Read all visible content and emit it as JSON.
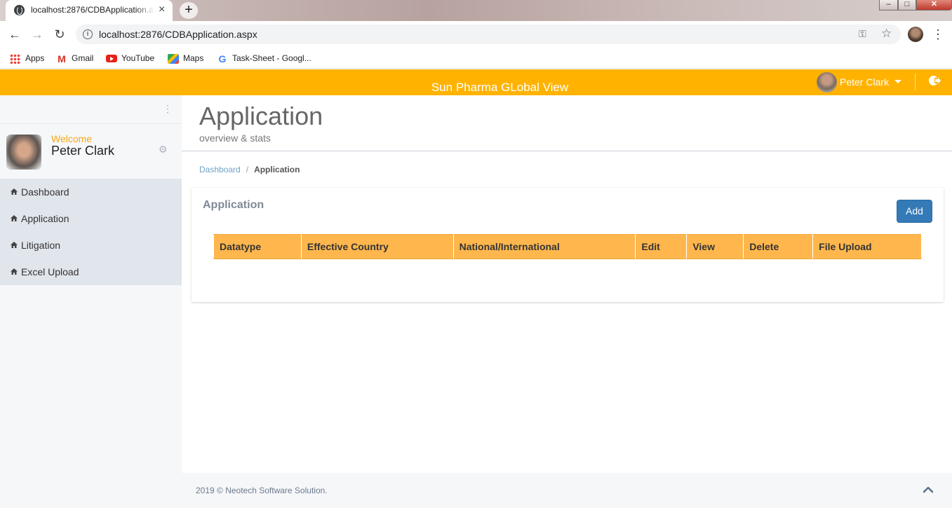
{
  "browser": {
    "tab_title": "localhost:2876/CDBApplication.aspx",
    "tab_close": "×",
    "new_tab": "+",
    "url": "localhost:2876/CDBApplication.aspx",
    "window_min": "–",
    "window_max": "□",
    "window_close": "✕",
    "bookmarks": [
      {
        "label": "Apps",
        "icon": "apps-grid-icon"
      },
      {
        "label": "Gmail",
        "icon": "gmail-icon"
      },
      {
        "label": "YouTube",
        "icon": "youtube-icon"
      },
      {
        "label": "Maps",
        "icon": "maps-icon"
      },
      {
        "label": "Task-Sheet - Googl...",
        "icon": "google-icon"
      }
    ]
  },
  "header": {
    "title": "Sun Pharma GLobal View",
    "user_name": "Peter Clark",
    "accent": "#ffb300"
  },
  "sidebar": {
    "welcome": "Welcome",
    "user_name": "Peter Clark",
    "items": [
      {
        "label": "Dashboard",
        "icon": "home-icon"
      },
      {
        "label": "Application",
        "icon": "home-icon"
      },
      {
        "label": "Litigation",
        "icon": "home-icon"
      },
      {
        "label": "Excel Upload",
        "icon": "home-icon"
      }
    ]
  },
  "page": {
    "title": "Application",
    "subtitle": "overview & stats",
    "breadcrumb": {
      "home": "Dashboard",
      "separator": "/",
      "current": "Application"
    }
  },
  "portlet": {
    "title": "Application",
    "add_label": "Add",
    "columns": [
      "Datatype",
      "Effective Country",
      "National/International",
      "Edit",
      "View",
      "Delete",
      "File Upload"
    ]
  },
  "footer": {
    "text": "2019 © Neotech Software Solution."
  }
}
